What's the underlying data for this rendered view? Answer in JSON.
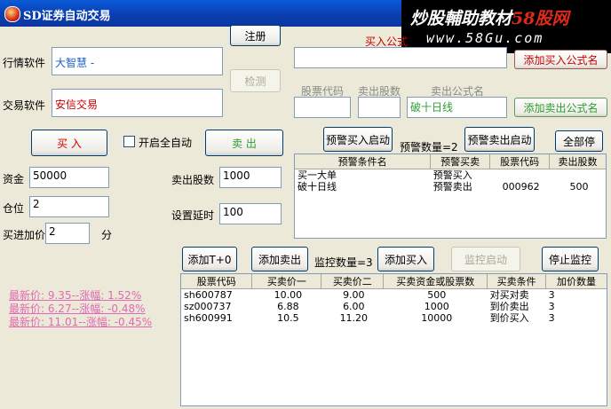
{
  "window": {
    "title": "SD证券自动交易"
  },
  "watermark": {
    "line1_a": "炒股輔助教材",
    "line1_b": "58股网",
    "line2": "www.58Gu.com"
  },
  "buttons": {
    "register": "注册",
    "detect": "检测",
    "buy": "买 入",
    "sell": "卖 出",
    "warn_buy_start": "预警买入启动",
    "warn_sell_start": "预警卖出启动",
    "all_stop": "全部停",
    "add_buy_formula": "添加买入公式名",
    "add_sell_formula": "添加卖出公式名",
    "add_t0": "添加T+0",
    "add_sell": "添加卖出",
    "add_buy": "添加买入",
    "monitor_start": "监控启动",
    "stop_monitor": "停止监控"
  },
  "labels": {
    "quote_software": "行情软件",
    "trade_software": "交易软件",
    "auto_start": "开启全自动",
    "capital": "资金",
    "position": "仓位",
    "buy_markup": "买进加价",
    "unit_fen": "分",
    "sell_shares": "卖出股数",
    "delay": "设置延时",
    "buy_formula": "买入公式",
    "stock_code": "股票代码",
    "sell_qty": "卖出股数",
    "sell_formula": "卖出公式名",
    "warn_count": "预警数量=2",
    "monitor_count": "监控数量=3"
  },
  "inputs": {
    "quote_software": "大智慧 -",
    "trade_software": "安信交易",
    "capital": "50000",
    "position": "2",
    "buy_markup": "2",
    "sell_shares": "1000",
    "delay": "100",
    "sell_formula": "破十日线"
  },
  "colors": {
    "titlebar": "#0a3fb0",
    "pink": "#e06ab5"
  },
  "warn_table": {
    "headers": [
      "预警条件名",
      "预警买卖",
      "股票代码",
      "卖出股数"
    ],
    "rows": [
      [
        "买一大单",
        "预警买入",
        "",
        ""
      ],
      [
        "破十日线",
        "预警卖出",
        "000962",
        "500"
      ]
    ]
  },
  "monitor_table": {
    "headers": [
      "股票代码",
      "买卖价一",
      "买卖价二",
      "买卖资金或股票数",
      "买卖条件",
      "加价数量"
    ],
    "rows": [
      [
        "sh600787",
        "10.00",
        "9.00",
        "500",
        "对买对卖",
        "3"
      ],
      [
        "sz000737",
        "6.88",
        "6.00",
        "1000",
        "到价卖出",
        "3"
      ],
      [
        "sh600991",
        "10.5",
        "11.20",
        "10000",
        "到价买入",
        "3"
      ]
    ]
  },
  "quotes": [
    "最新价: 9.35--涨幅: 1.52%",
    "最新价: 6.27--涨幅: -0.48%",
    "最新价: 11.01--涨幅: -0.45%"
  ]
}
